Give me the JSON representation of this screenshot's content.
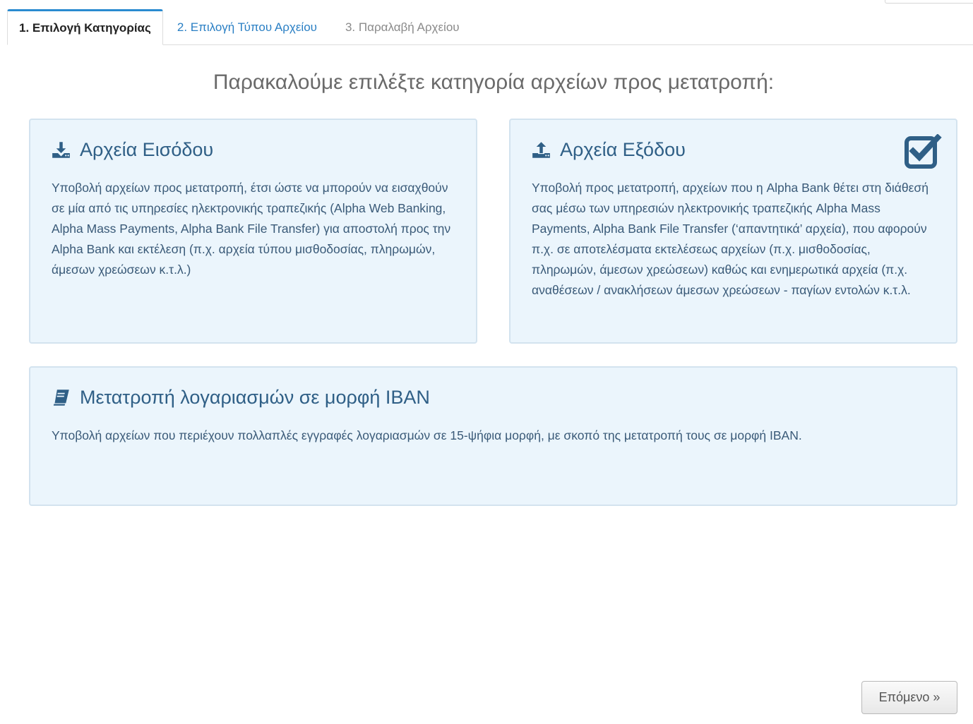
{
  "tabs": [
    {
      "label": "1. Επιλογή Κατηγορίας",
      "state": "active"
    },
    {
      "label": "2. Επιλογή Τύπου Αρχείου",
      "state": "link"
    },
    {
      "label": "3. Παραλαβή Αρχείου",
      "state": "disabled"
    }
  ],
  "heading": "Παρακαλούμε επιλέξτε κατηγορία αρχείων προς μετατροπή:",
  "cards": {
    "input": {
      "icon": "download-icon",
      "title": "Αρχεία Εισόδου",
      "text": "Υποβολή αρχείων προς μετατροπή, έτσι ώστε να μπορούν να εισαχθούν σε μία από τις υπηρεσίες ηλεκτρονικής τραπεζικής (Alpha Web Banking, Alpha Mass Payments, Alpha Bank File Transfer) για αποστολή προς την Alpha Bank και εκτέλεση (π.χ. αρχεία τύπου μισθοδοσίας, πληρωμών, άμεσων χρεώσεων κ.τ.λ.)"
    },
    "output": {
      "icon": "upload-icon",
      "title": "Αρχεία Εξόδου",
      "text": "Υποβολή προς μετατροπή, αρχείων που η Alpha Bank θέτει στη διάθεσή σας μέσω των υπηρεσιών ηλεκτρονικής τραπεζικής Alpha Mass Payments, Alpha Bank File Transfer (‘απαντητικά’ αρχεία), που αφορούν π.χ. σε αποτελέσματα εκτελέσεως αρχείων (π.χ. μισθοδοσίας, πληρωμών, άμεσων χρεώσεων) καθώς και ενημερωτικά αρχεία (π.χ. αναθέσεων / ανακλήσεων άμεσων χρεώσεων - παγίων εντολών κ.τ.λ.",
      "selected": true,
      "selected_icon": "checked-checkbox-icon"
    },
    "iban": {
      "icon": "book-icon",
      "title": "Μετατροπή λογαριασμών σε μορφή IBAN",
      "text": "Υποβολή αρχείων που περιέχουν πολλαπλές εγγραφές λογαριασμών σε 15-ψήφια μορφή, με σκοπό της μετατροπή τους σε μορφή IBAN."
    }
  },
  "buttons": {
    "next_label": "Επόμενο »"
  },
  "colors": {
    "accent": "#2a8bd0",
    "card_bg": "#ebf5fc",
    "card_title": "#2f5f86",
    "link": "#2a7fc4"
  }
}
